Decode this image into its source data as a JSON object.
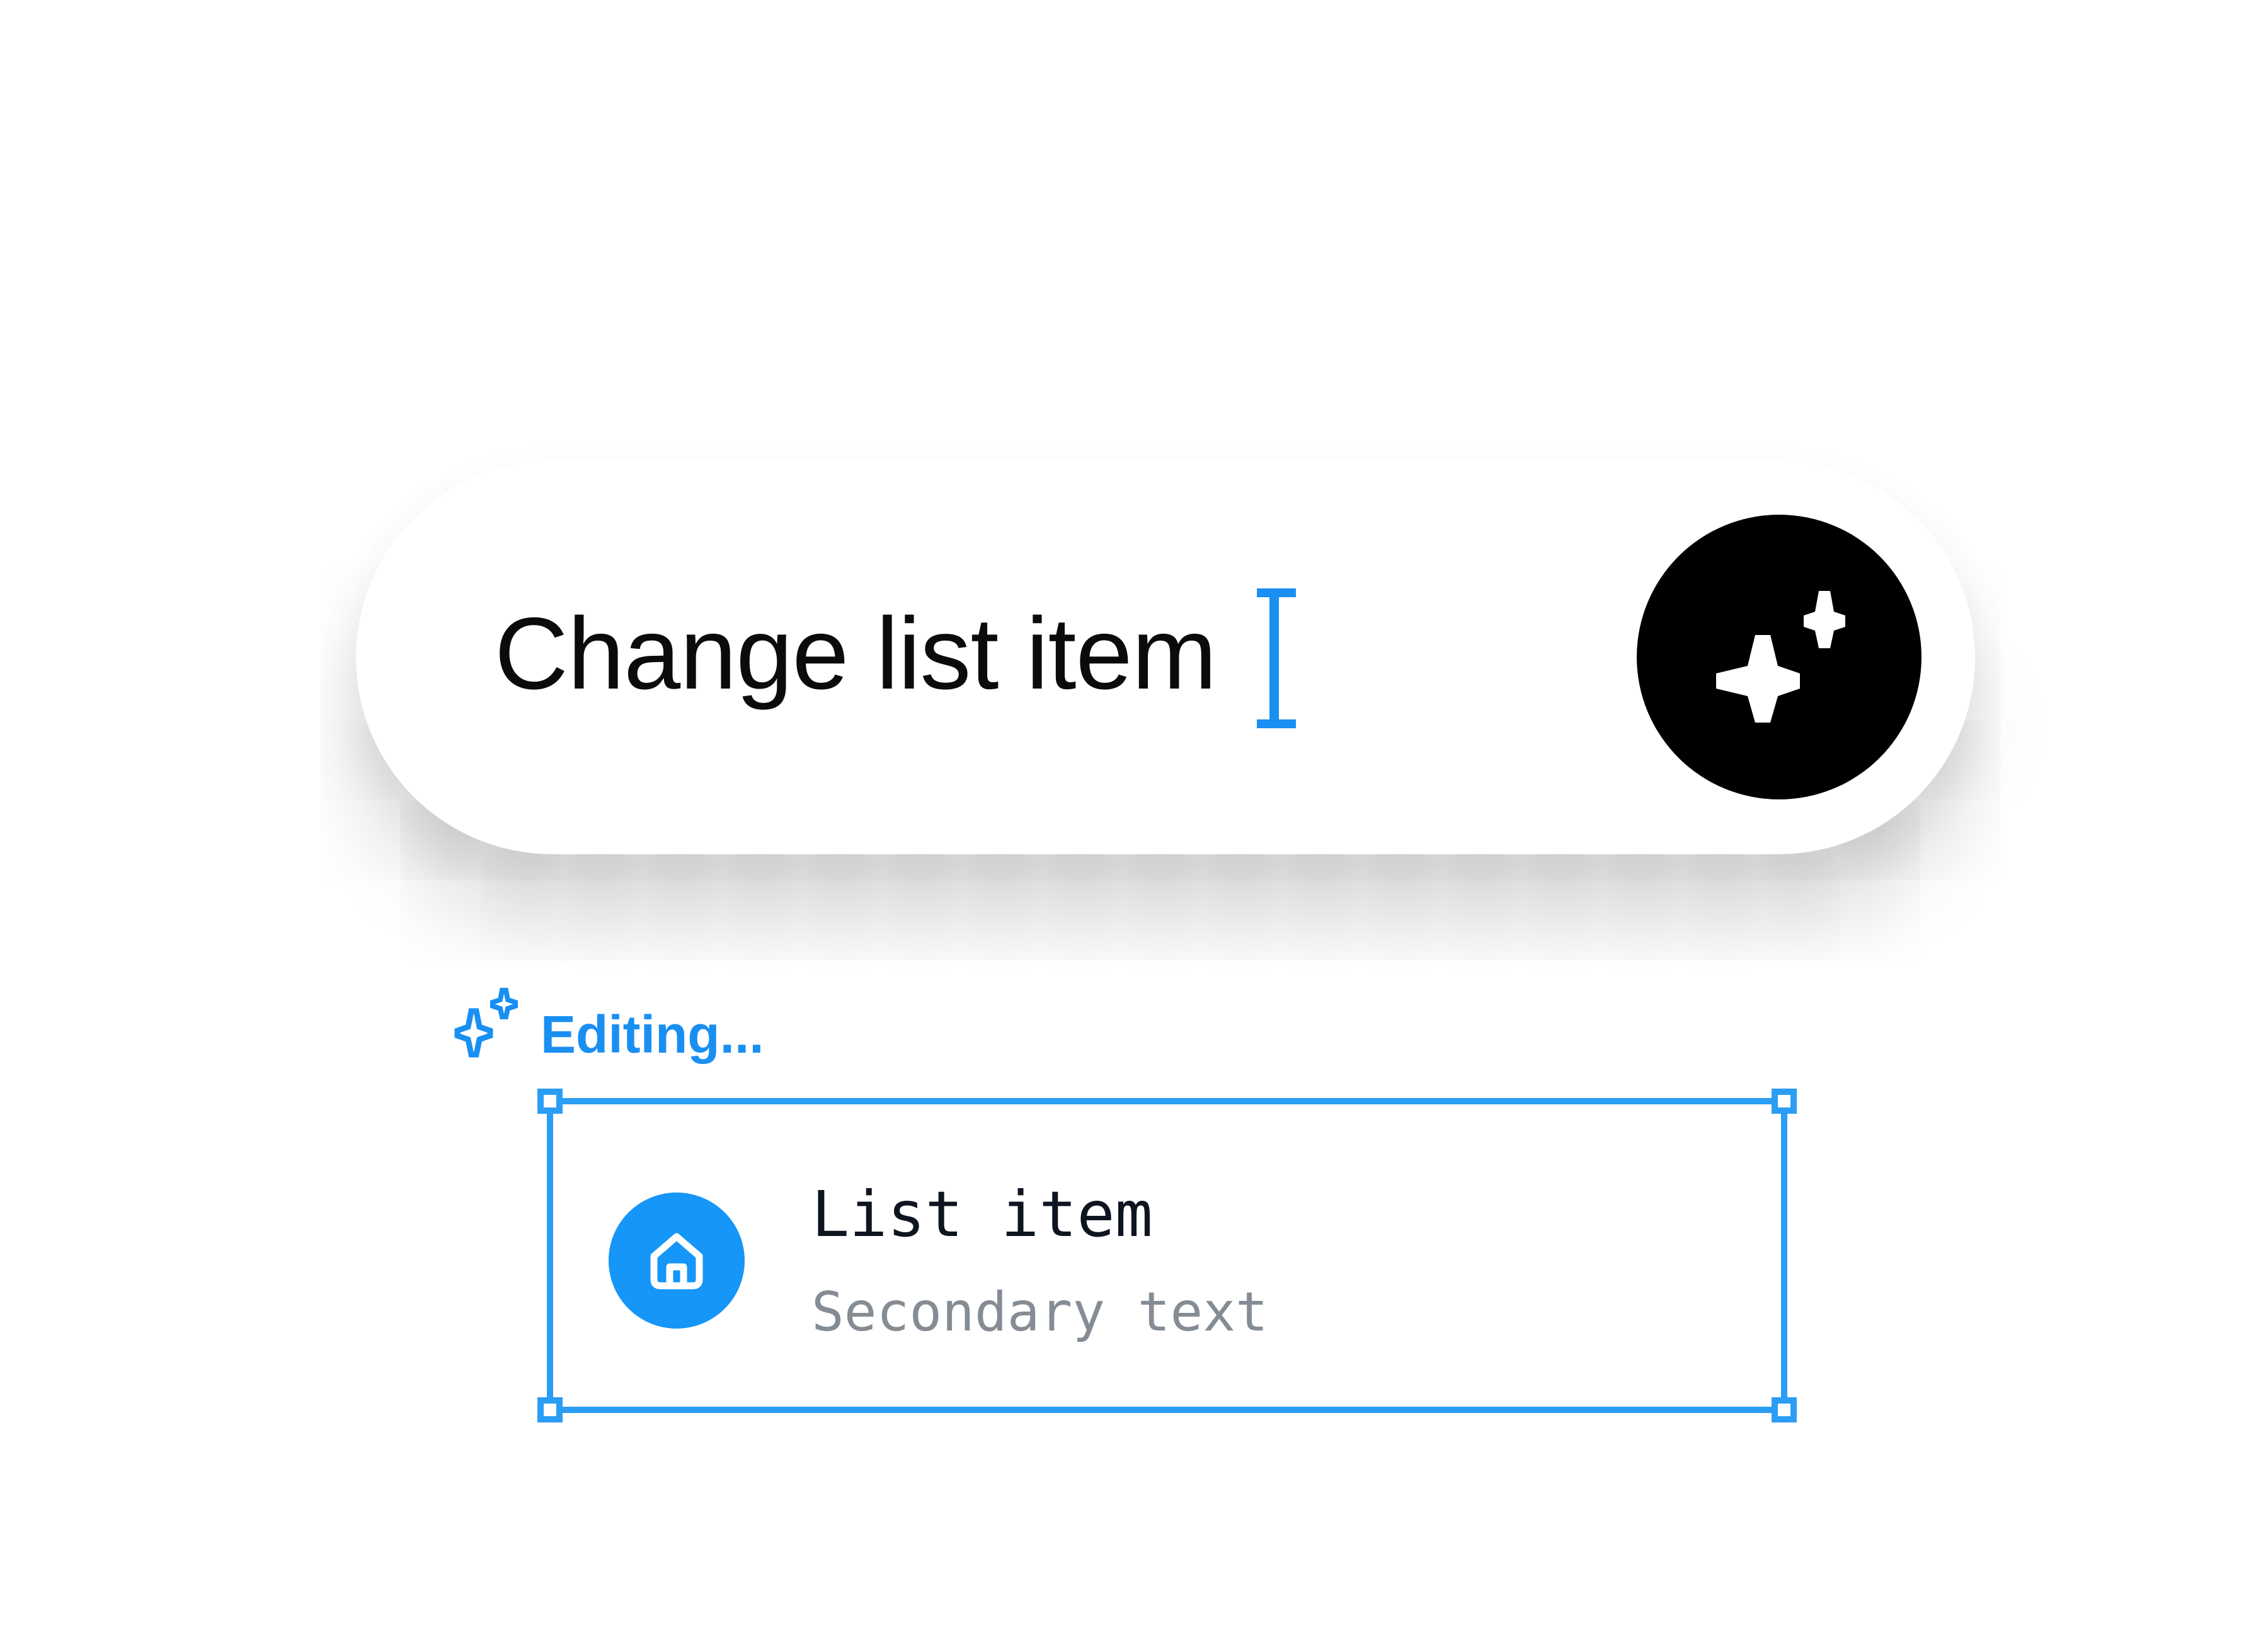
{
  "prompt": {
    "value": "Change list item",
    "submit_icon": "sparkles-icon"
  },
  "status": {
    "icon": "sparkles-icon",
    "label": "Editing..."
  },
  "list_item": {
    "leading_icon": "home-icon",
    "primary_text": "List item",
    "secondary_text": "Secondary text"
  },
  "colors": {
    "accent": "#2a9df4",
    "status_text": "#1a8ff2",
    "avatar_bg": "#1596f8",
    "submit_bg": "#000000",
    "secondary_text": "#858c94"
  }
}
